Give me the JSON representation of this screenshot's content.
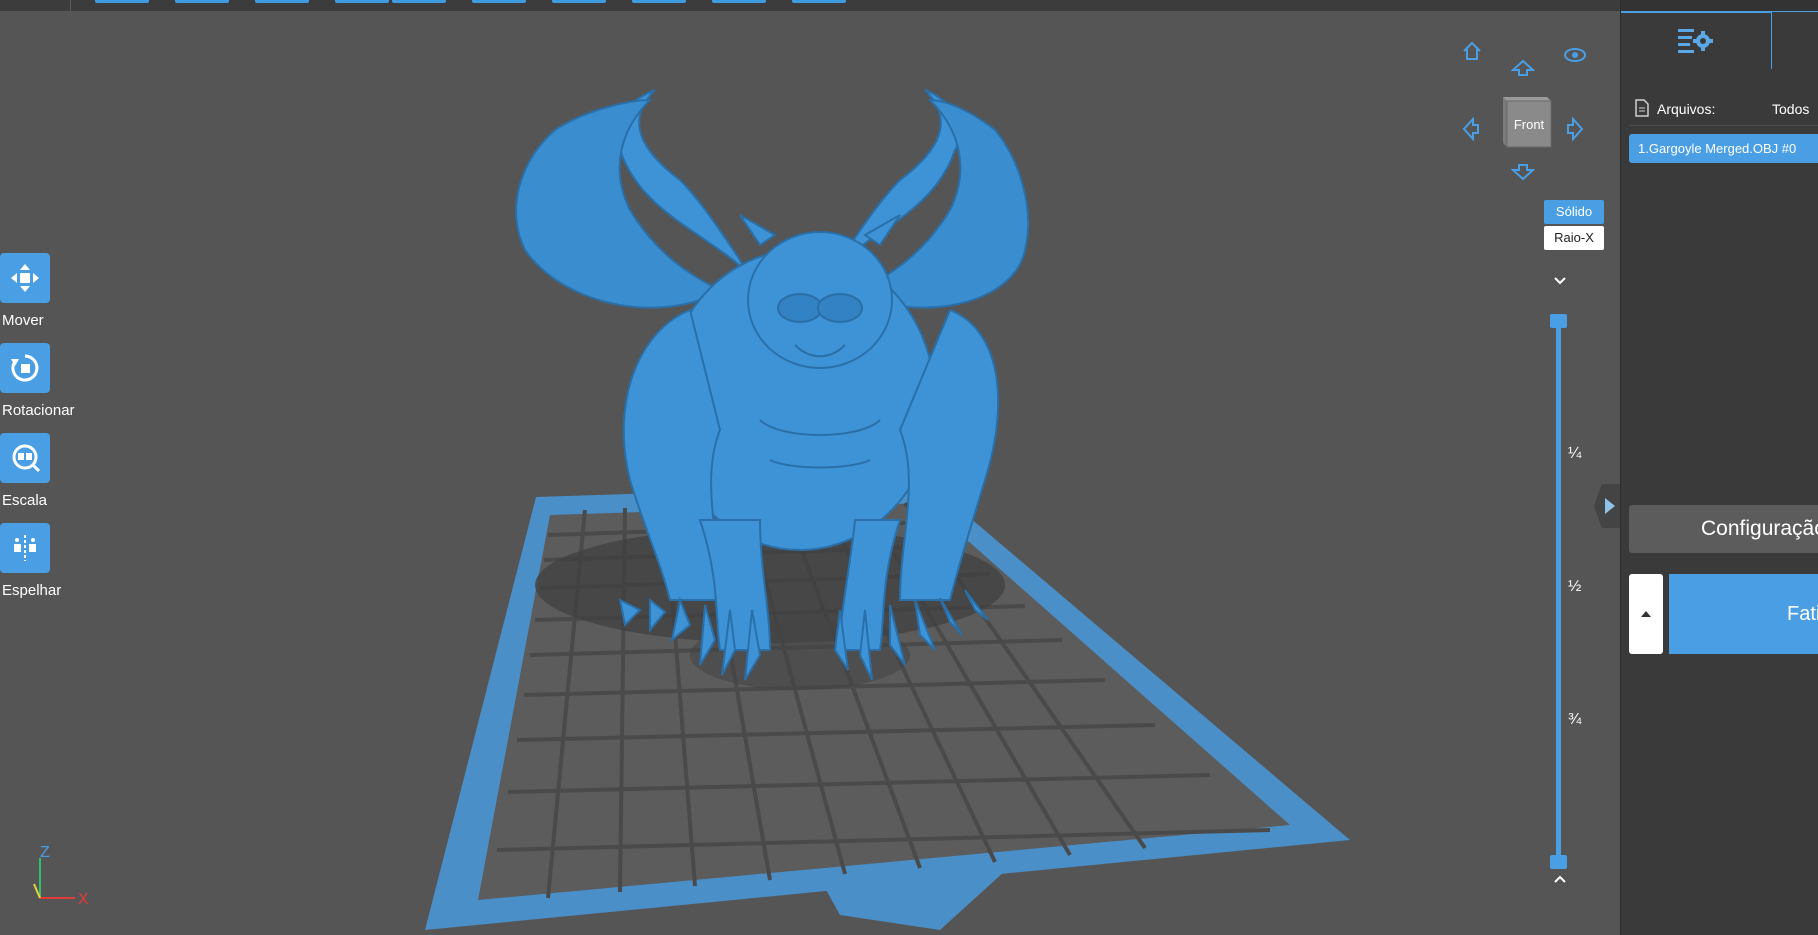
{
  "colors": {
    "accent": "#4a9fe4",
    "viewport_bg": "#555555",
    "panel_bg": "#3a3a3a"
  },
  "tools": [
    {
      "id": "move",
      "label": "Mover",
      "icon": "move-icon"
    },
    {
      "id": "rotate",
      "label": "Rotacionar",
      "icon": "rotate-icon"
    },
    {
      "id": "scale",
      "label": "Escala",
      "icon": "scale-icon"
    },
    {
      "id": "mirror",
      "label": "Espelhar",
      "icon": "mirror-icon"
    }
  ],
  "nav_cube": {
    "face_label": "Front"
  },
  "view_modes": {
    "solid": "Sólido",
    "xray": "Raio-X",
    "active": "solid"
  },
  "layer_slider": {
    "ticks": [
      "¼",
      "½",
      "¾"
    ]
  },
  "right_panel": {
    "files_label": "Arquivos:",
    "files_filter": "Todos",
    "file_item": "1.Gargoyle Merged.OBJ #0",
    "config_button": "Configuração",
    "slice_button": "Fatiar"
  },
  "axes": {
    "z": "Z",
    "x": "X"
  }
}
